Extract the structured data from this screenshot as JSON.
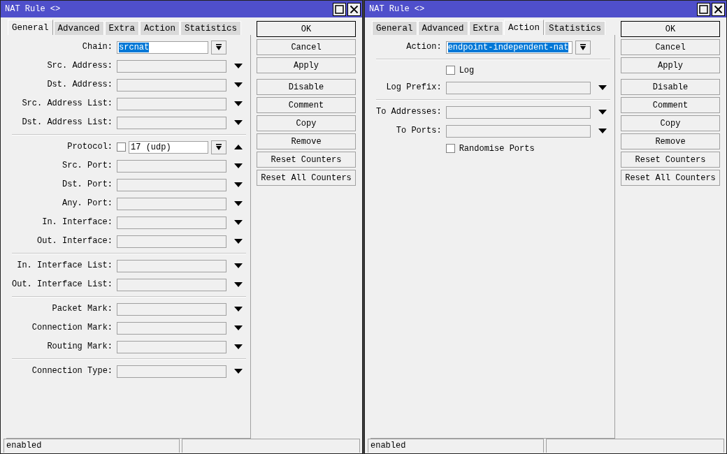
{
  "windows": [
    {
      "title": "NAT Rule <>",
      "tabs": [
        {
          "label": "General",
          "selected": true
        },
        {
          "label": "Advanced",
          "selected": false
        },
        {
          "label": "Extra",
          "selected": false
        },
        {
          "label": "Action",
          "selected": false
        },
        {
          "label": "Statistics",
          "selected": false
        }
      ],
      "groups": [
        [
          {
            "kind": "select",
            "label": "Chain:",
            "value": "srcnat",
            "highlighted": true
          },
          {
            "kind": "field",
            "label": "Src. Address:",
            "expanded": false
          },
          {
            "kind": "field",
            "label": "Dst. Address:",
            "expanded": false
          },
          {
            "kind": "field",
            "label": "Src. Address List:",
            "expanded": false
          },
          {
            "kind": "field",
            "label": "Dst. Address List:",
            "expanded": false
          }
        ],
        [
          {
            "kind": "negated-select",
            "label": "Protocol:",
            "checked": false,
            "value": "17 (udp)",
            "highlighted": false,
            "expanded": true
          },
          {
            "kind": "field",
            "label": "Src. Port:",
            "expanded": false
          },
          {
            "kind": "field",
            "label": "Dst. Port:",
            "expanded": false
          },
          {
            "kind": "field",
            "label": "Any. Port:",
            "expanded": false
          },
          {
            "kind": "field",
            "label": "In. Interface:",
            "expanded": false
          },
          {
            "kind": "field",
            "label": "Out. Interface:",
            "expanded": false
          }
        ],
        [
          {
            "kind": "field",
            "label": "In. Interface List:",
            "expanded": false
          },
          {
            "kind": "field",
            "label": "Out. Interface List:",
            "expanded": false
          }
        ],
        [
          {
            "kind": "field",
            "label": "Packet Mark:",
            "expanded": false
          },
          {
            "kind": "field",
            "label": "Connection Mark:",
            "expanded": false
          },
          {
            "kind": "field",
            "label": "Routing Mark:",
            "expanded": false
          }
        ],
        [
          {
            "kind": "field",
            "label": "Connection Type:",
            "expanded": false
          }
        ]
      ],
      "buttons": [
        [
          "OK",
          "Cancel",
          "Apply"
        ],
        [
          "Disable",
          "Comment",
          "Copy",
          "Remove",
          "Reset Counters",
          "Reset All Counters"
        ]
      ],
      "status": "enabled"
    },
    {
      "title": "NAT Rule <>",
      "tabs": [
        {
          "label": "General",
          "selected": false
        },
        {
          "label": "Advanced",
          "selected": false
        },
        {
          "label": "Extra",
          "selected": false
        },
        {
          "label": "Action",
          "selected": true
        },
        {
          "label": "Statistics",
          "selected": false
        }
      ],
      "groups": [
        [
          {
            "kind": "select",
            "label": "Action:",
            "value": "endpoint-independent-nat",
            "highlighted": true
          }
        ],
        [
          {
            "kind": "checkbox",
            "label": "Log",
            "checked": false
          },
          {
            "kind": "field",
            "label": "Log Prefix:",
            "expanded": false
          }
        ],
        [
          {
            "kind": "field",
            "label": "To Addresses:",
            "expanded": false
          },
          {
            "kind": "field",
            "label": "To Ports:",
            "expanded": false
          },
          {
            "kind": "checkbox",
            "label": "Randomise Ports",
            "checked": false
          }
        ]
      ],
      "buttons": [
        [
          "OK",
          "Cancel",
          "Apply"
        ],
        [
          "Disable",
          "Comment",
          "Copy",
          "Remove",
          "Reset Counters",
          "Reset All Counters"
        ]
      ],
      "status": "enabled"
    }
  ]
}
